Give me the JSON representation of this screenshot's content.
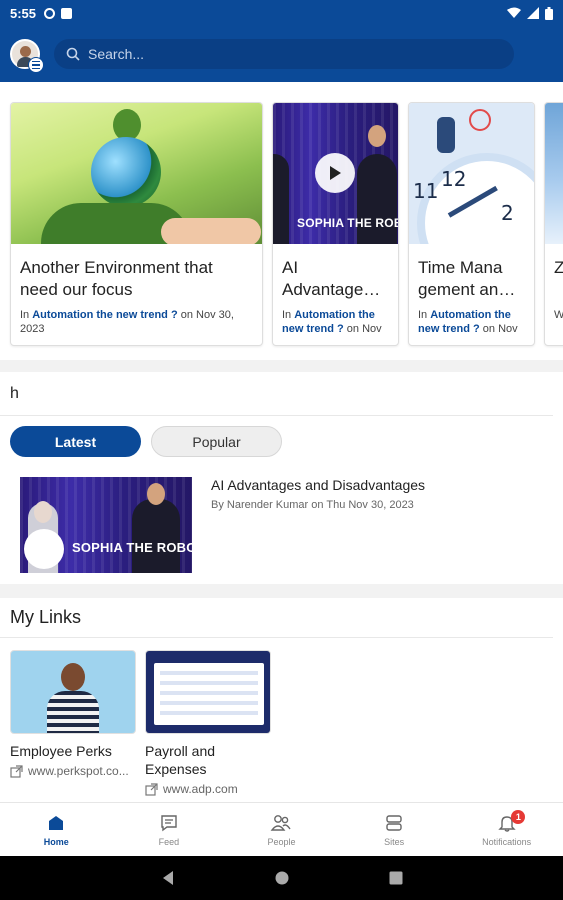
{
  "status_bar": {
    "time": "5:55"
  },
  "search": {
    "placeholder": "Search..."
  },
  "featured": [
    {
      "title": "Another Environment that need our focus",
      "in_label": "In ",
      "category": "Automation the new trend ?",
      "date": " on Nov 30, 2023"
    },
    {
      "title": "AI Advantage…",
      "in_label": "In ",
      "category": "Automation the new trend ?",
      "date": " on Nov"
    },
    {
      "title": "Time Mana gement an…",
      "in_label": "In ",
      "category": "Automation the new trend ?",
      "date": " on Nov"
    },
    {
      "title": "Z",
      "in_label": "W",
      "category": "",
      "date": ""
    }
  ],
  "featured_video_caption": "SOPHIA THE ROBOT",
  "feed_section": {
    "heading": "h",
    "tabs": [
      {
        "label": "Latest"
      },
      {
        "label": "Popular"
      }
    ],
    "items": [
      {
        "title": "AI Advantages and Disadvantages",
        "meta": "By Narender Kumar on Thu Nov 30, 2023",
        "thumb_caption": "SOPHIA THE ROBOT"
      }
    ]
  },
  "my_links": {
    "heading": "My Links",
    "items": [
      {
        "title": "Employee Perks",
        "url": "www.perkspot.co..."
      },
      {
        "title": "Payroll and Expenses",
        "url": "www.adp.com"
      }
    ]
  },
  "bottom_nav": [
    {
      "label": "Home",
      "icon": "home-icon"
    },
    {
      "label": "Feed",
      "icon": "feed-icon"
    },
    {
      "label": "People",
      "icon": "people-icon"
    },
    {
      "label": "Sites",
      "icon": "sites-icon"
    },
    {
      "label": "Notifications",
      "icon": "bell-icon",
      "badge": "1"
    }
  ],
  "colors": {
    "brand": "#0b4a98",
    "badge": "#e53935"
  }
}
